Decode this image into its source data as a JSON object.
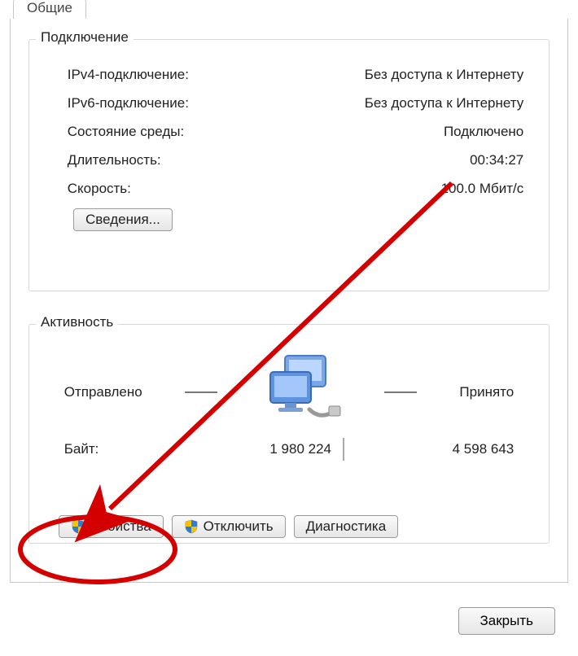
{
  "tab": {
    "label": "Общие"
  },
  "connection": {
    "title": "Подключение",
    "rows": [
      {
        "label": "IPv4-подключение:",
        "value": "Без доступа к Интернету"
      },
      {
        "label": "IPv6-подключение:",
        "value": "Без доступа к Интернету"
      },
      {
        "label": "Состояние среды:",
        "value": "Подключено"
      },
      {
        "label": "Длительность:",
        "value": "00:34:27"
      },
      {
        "label": "Скорость:",
        "value": "100.0 Мбит/с"
      }
    ],
    "details_button": "Сведения..."
  },
  "activity": {
    "title": "Активность",
    "sent_label": "Отправлено",
    "recv_label": "Принято",
    "bytes_label": "Байт:",
    "bytes_sent": "1 980 224",
    "bytes_recv": "4 598 643"
  },
  "buttons": {
    "properties": "Свойства",
    "disable": "Отключить",
    "diagnose": "Диагностика",
    "close": "Закрыть"
  }
}
